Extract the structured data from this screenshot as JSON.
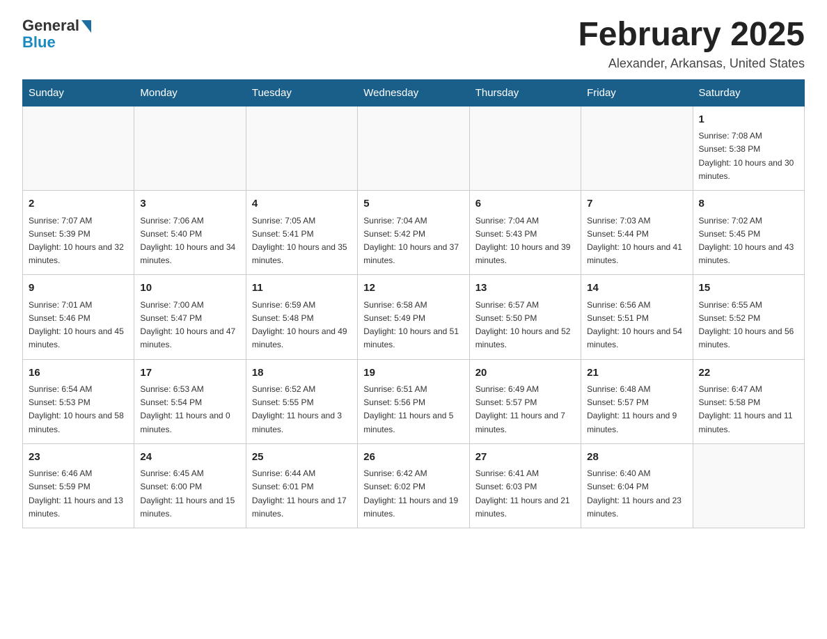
{
  "logo": {
    "general": "General",
    "blue": "Blue"
  },
  "title": "February 2025",
  "location": "Alexander, Arkansas, United States",
  "days_of_week": [
    "Sunday",
    "Monday",
    "Tuesday",
    "Wednesday",
    "Thursday",
    "Friday",
    "Saturday"
  ],
  "weeks": [
    [
      {
        "day": "",
        "info": ""
      },
      {
        "day": "",
        "info": ""
      },
      {
        "day": "",
        "info": ""
      },
      {
        "day": "",
        "info": ""
      },
      {
        "day": "",
        "info": ""
      },
      {
        "day": "",
        "info": ""
      },
      {
        "day": "1",
        "info": "Sunrise: 7:08 AM\nSunset: 5:38 PM\nDaylight: 10 hours and 30 minutes."
      }
    ],
    [
      {
        "day": "2",
        "info": "Sunrise: 7:07 AM\nSunset: 5:39 PM\nDaylight: 10 hours and 32 minutes."
      },
      {
        "day": "3",
        "info": "Sunrise: 7:06 AM\nSunset: 5:40 PM\nDaylight: 10 hours and 34 minutes."
      },
      {
        "day": "4",
        "info": "Sunrise: 7:05 AM\nSunset: 5:41 PM\nDaylight: 10 hours and 35 minutes."
      },
      {
        "day": "5",
        "info": "Sunrise: 7:04 AM\nSunset: 5:42 PM\nDaylight: 10 hours and 37 minutes."
      },
      {
        "day": "6",
        "info": "Sunrise: 7:04 AM\nSunset: 5:43 PM\nDaylight: 10 hours and 39 minutes."
      },
      {
        "day": "7",
        "info": "Sunrise: 7:03 AM\nSunset: 5:44 PM\nDaylight: 10 hours and 41 minutes."
      },
      {
        "day": "8",
        "info": "Sunrise: 7:02 AM\nSunset: 5:45 PM\nDaylight: 10 hours and 43 minutes."
      }
    ],
    [
      {
        "day": "9",
        "info": "Sunrise: 7:01 AM\nSunset: 5:46 PM\nDaylight: 10 hours and 45 minutes."
      },
      {
        "day": "10",
        "info": "Sunrise: 7:00 AM\nSunset: 5:47 PM\nDaylight: 10 hours and 47 minutes."
      },
      {
        "day": "11",
        "info": "Sunrise: 6:59 AM\nSunset: 5:48 PM\nDaylight: 10 hours and 49 minutes."
      },
      {
        "day": "12",
        "info": "Sunrise: 6:58 AM\nSunset: 5:49 PM\nDaylight: 10 hours and 51 minutes."
      },
      {
        "day": "13",
        "info": "Sunrise: 6:57 AM\nSunset: 5:50 PM\nDaylight: 10 hours and 52 minutes."
      },
      {
        "day": "14",
        "info": "Sunrise: 6:56 AM\nSunset: 5:51 PM\nDaylight: 10 hours and 54 minutes."
      },
      {
        "day": "15",
        "info": "Sunrise: 6:55 AM\nSunset: 5:52 PM\nDaylight: 10 hours and 56 minutes."
      }
    ],
    [
      {
        "day": "16",
        "info": "Sunrise: 6:54 AM\nSunset: 5:53 PM\nDaylight: 10 hours and 58 minutes."
      },
      {
        "day": "17",
        "info": "Sunrise: 6:53 AM\nSunset: 5:54 PM\nDaylight: 11 hours and 0 minutes."
      },
      {
        "day": "18",
        "info": "Sunrise: 6:52 AM\nSunset: 5:55 PM\nDaylight: 11 hours and 3 minutes."
      },
      {
        "day": "19",
        "info": "Sunrise: 6:51 AM\nSunset: 5:56 PM\nDaylight: 11 hours and 5 minutes."
      },
      {
        "day": "20",
        "info": "Sunrise: 6:49 AM\nSunset: 5:57 PM\nDaylight: 11 hours and 7 minutes."
      },
      {
        "day": "21",
        "info": "Sunrise: 6:48 AM\nSunset: 5:57 PM\nDaylight: 11 hours and 9 minutes."
      },
      {
        "day": "22",
        "info": "Sunrise: 6:47 AM\nSunset: 5:58 PM\nDaylight: 11 hours and 11 minutes."
      }
    ],
    [
      {
        "day": "23",
        "info": "Sunrise: 6:46 AM\nSunset: 5:59 PM\nDaylight: 11 hours and 13 minutes."
      },
      {
        "day": "24",
        "info": "Sunrise: 6:45 AM\nSunset: 6:00 PM\nDaylight: 11 hours and 15 minutes."
      },
      {
        "day": "25",
        "info": "Sunrise: 6:44 AM\nSunset: 6:01 PM\nDaylight: 11 hours and 17 minutes."
      },
      {
        "day": "26",
        "info": "Sunrise: 6:42 AM\nSunset: 6:02 PM\nDaylight: 11 hours and 19 minutes."
      },
      {
        "day": "27",
        "info": "Sunrise: 6:41 AM\nSunset: 6:03 PM\nDaylight: 11 hours and 21 minutes."
      },
      {
        "day": "28",
        "info": "Sunrise: 6:40 AM\nSunset: 6:04 PM\nDaylight: 11 hours and 23 minutes."
      },
      {
        "day": "",
        "info": ""
      }
    ]
  ]
}
